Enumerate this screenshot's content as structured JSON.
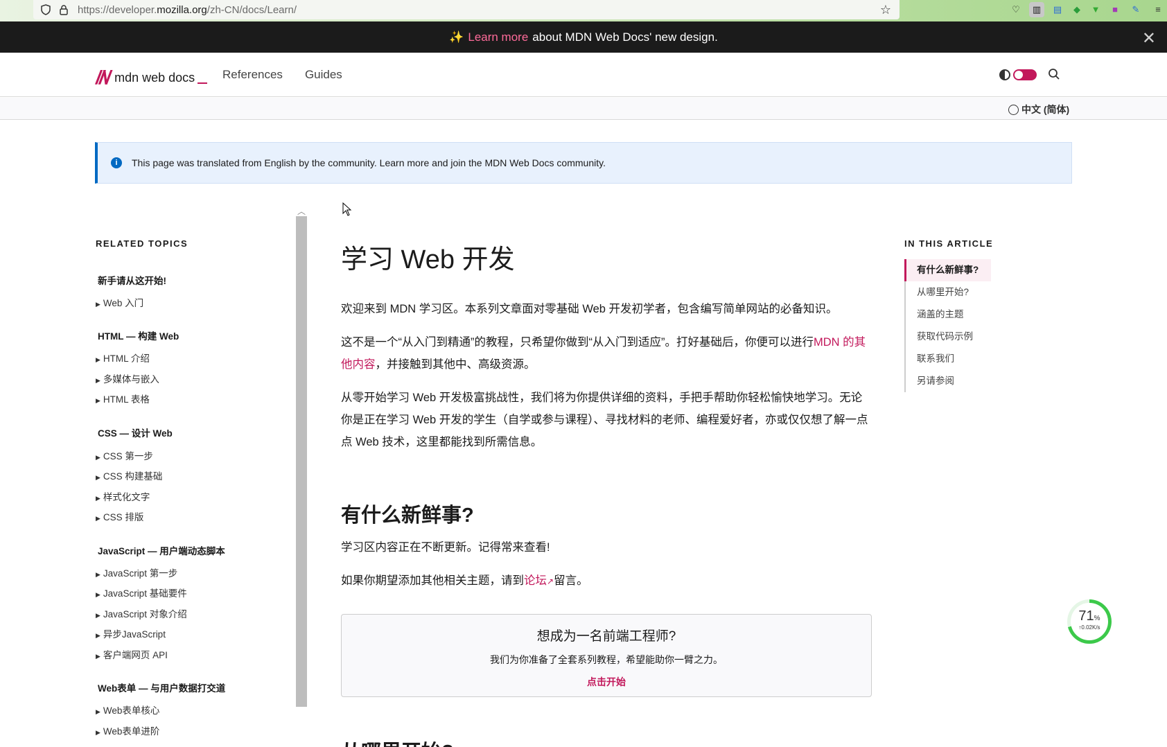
{
  "browser": {
    "url_prefix": "https://developer.",
    "url_domain": "mozilla.org",
    "url_path": "/zh-CN/docs/Learn/"
  },
  "banner": {
    "sparkle": "✨",
    "link": "Learn more",
    "text": "about MDN Web Docs' new design."
  },
  "header": {
    "logo_text": "mdn web docs",
    "nav": [
      "References",
      "Guides"
    ]
  },
  "lang": {
    "label": "中文 (简体)"
  },
  "notice": {
    "text": "This page was translated from English by the community. Learn more and join the MDN Web Docs community."
  },
  "sidebar": {
    "heading": "RELATED TOPICS",
    "groups": [
      {
        "title": "新手请从这开始!",
        "items": [
          "Web 入门"
        ]
      },
      {
        "title": "HTML — 构建 Web",
        "items": [
          "HTML 介绍",
          "多媒体与嵌入",
          "HTML 表格"
        ]
      },
      {
        "title": "CSS — 设计 Web",
        "items": [
          "CSS 第一步",
          "CSS 构建基础",
          "样式化文字",
          "CSS 排版"
        ]
      },
      {
        "title": "JavaScript — 用户端动态脚本",
        "items": [
          "JavaScript 第一步",
          "JavaScript 基础要件",
          "JavaScript 对象介绍",
          "异步JavaScript",
          "客户端网页 API"
        ]
      },
      {
        "title": "Web表单 — 与用户数据打交道",
        "items": [
          "Web表单核心",
          "Web表单进阶"
        ]
      }
    ]
  },
  "main": {
    "title": "学习 Web 开发",
    "p1": "欢迎来到 MDN 学习区。本系列文章面对零基础 Web 开发初学者，包含编写简单网站的必备知识。",
    "p2a": "这不是一个“从入门到精通”的教程，只希望你做到“从入门到适应”。打好基础后，你便可以进行",
    "p2_link": "MDN 的其他内容",
    "p2b": "，并接触到其他中、高级资源。",
    "p3": "从零开始学习 Web 开发极富挑战性，我们将为你提供详细的资料，手把手帮助你轻松愉快地学习。无论你是正在学习 Web 开发的学生（自学或参与课程）、寻找材料的老师、编程爱好者，亦或仅仅想了解一点点 Web 技术，这里都能找到所需信息。",
    "h2": "有什么新鲜事?",
    "p4": "学习区内容正在不断更新。记得常来查看!",
    "p5a": "如果你期望添加其他相关主题，请到",
    "p5_link": "论坛",
    "p5b": "留言。",
    "cta_title": "想成为一名前端工程师?",
    "cta_sub": "我们为你准备了全套系列教程，希望能助你一臂之力。",
    "cta_link": "点击开始",
    "next_h": "从哪里开始?"
  },
  "toc": {
    "heading": "IN THIS ARTICLE",
    "items": [
      "有什么新鲜事?",
      "从哪里开始?",
      "涵盖的主题",
      "获取代码示例",
      "联系我们",
      "另请参阅"
    ]
  },
  "meter": {
    "percent": "71",
    "unit": "%",
    "speed": "↑0.02K/s",
    "value": 0.71
  },
  "colors": {
    "accent": "#c2185b",
    "info": "#0069c2",
    "banner_bg": "#1b1b1b"
  }
}
